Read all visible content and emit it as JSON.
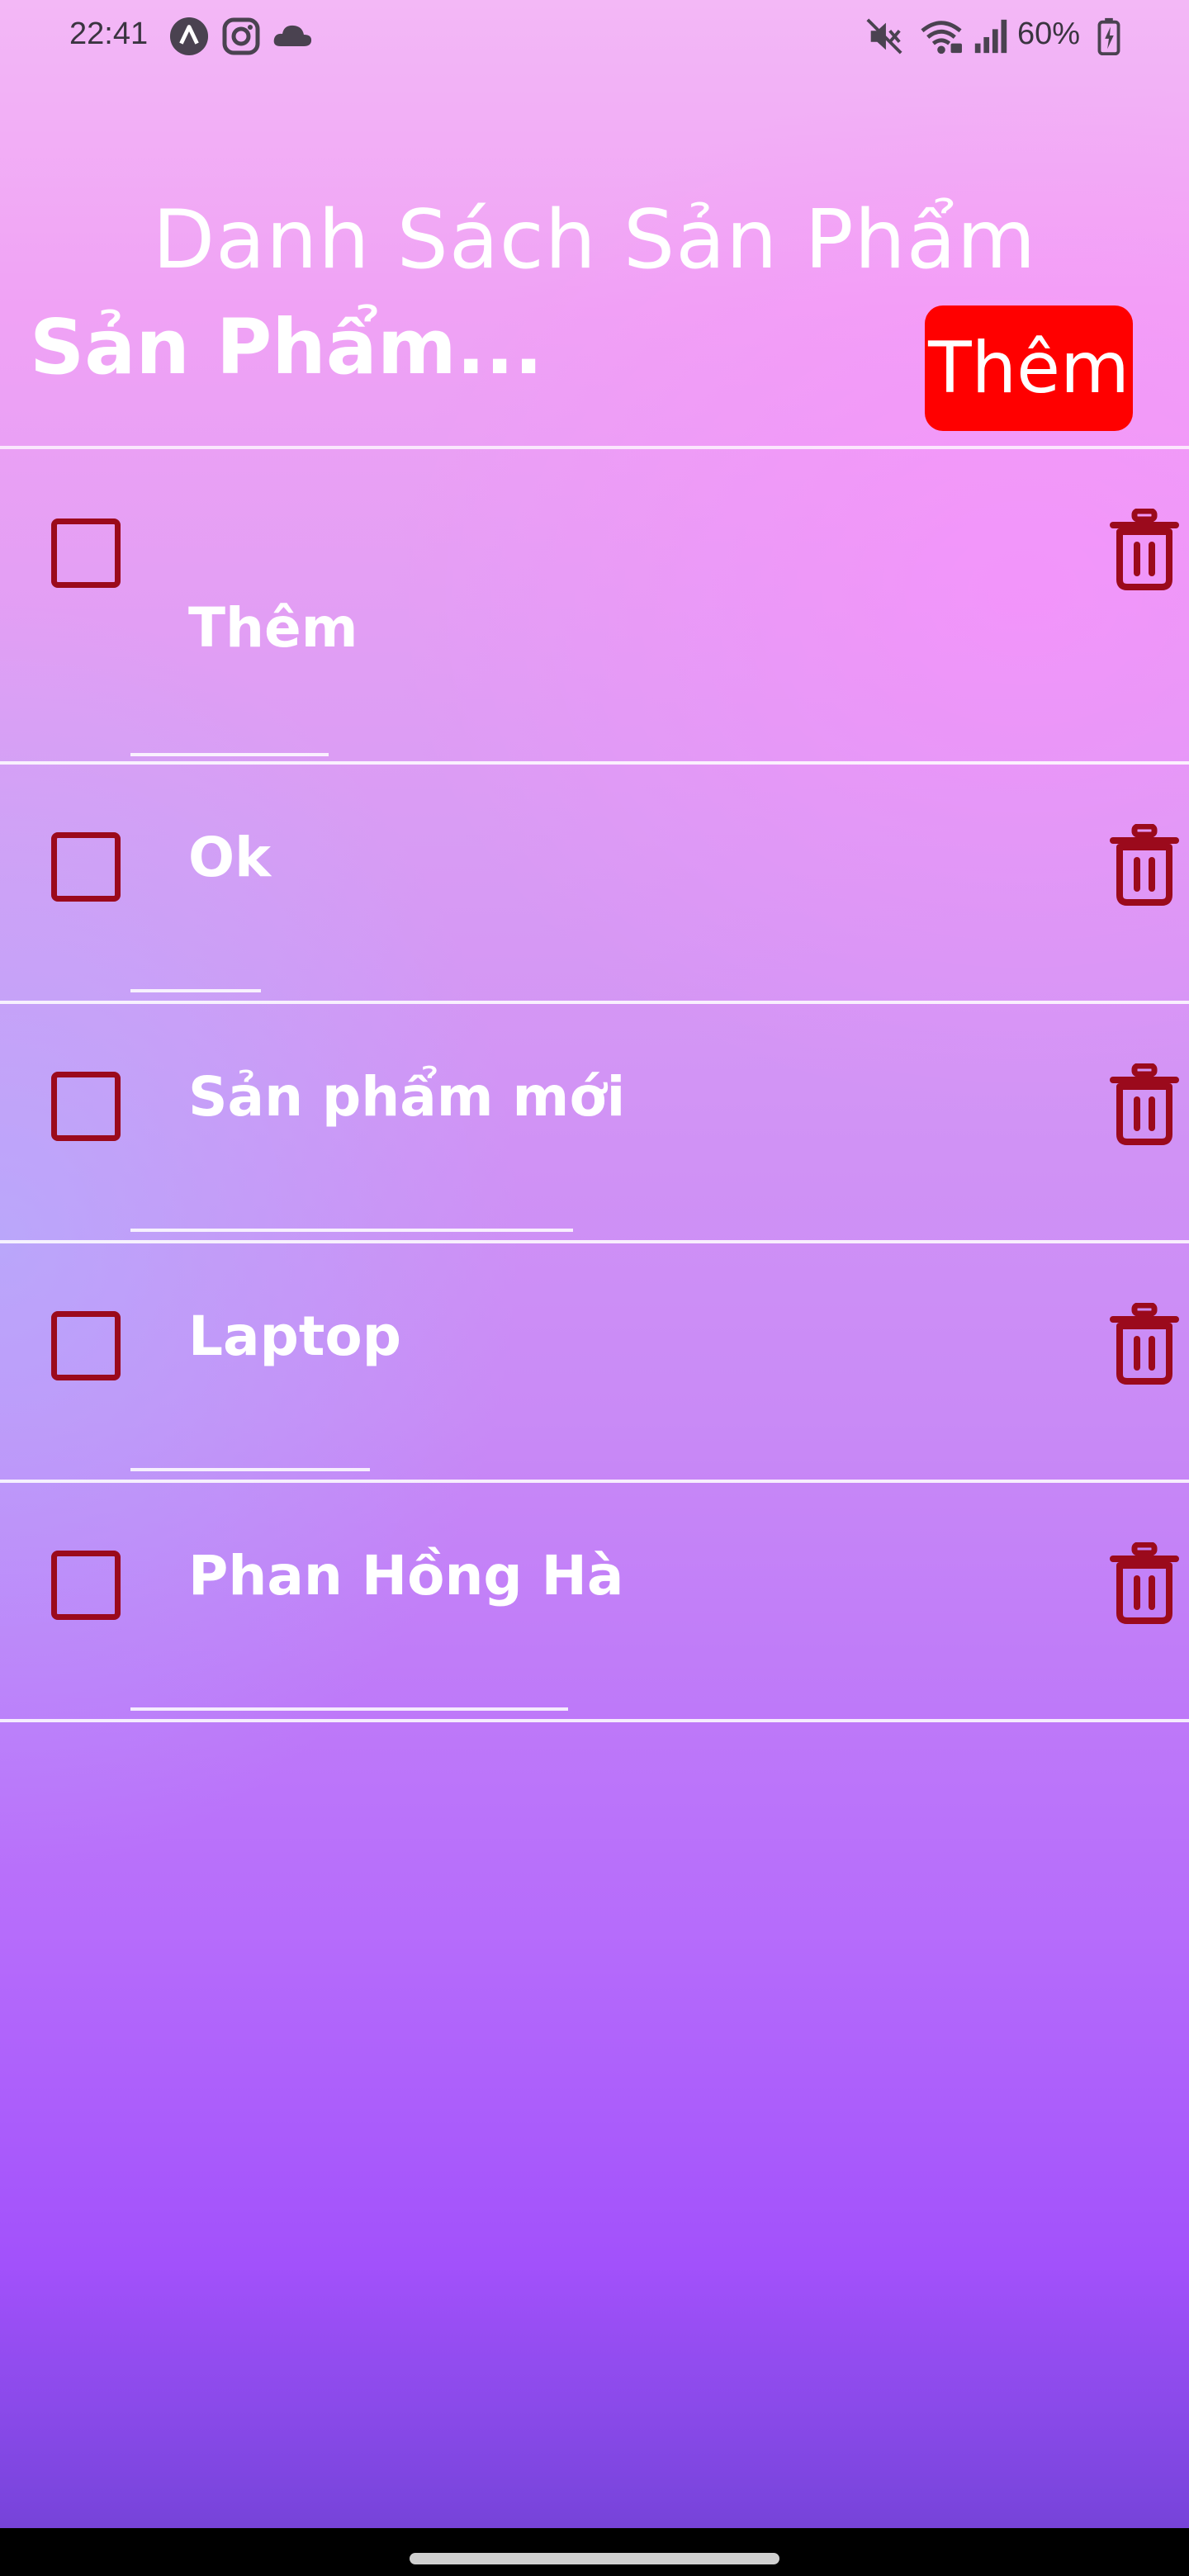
{
  "status_bar": {
    "time": "22:41",
    "battery": "60%",
    "left_icons": [
      "app-a-icon",
      "instagram-icon",
      "cloud-icon"
    ],
    "right_icons": [
      "mute-icon",
      "wifi-icon",
      "signal-icon",
      "battery-charging-icon"
    ]
  },
  "header": {
    "title": "Danh Sách Sản Phẩm",
    "input_placeholder": "Sản Phẩm...",
    "add_button_label": "Thêm"
  },
  "colors": {
    "accent_red": "#ff0000",
    "dark_red": "#9b0a1c",
    "text_white": "#ffffff"
  },
  "products": [
    {
      "name": "Thêm",
      "checked": false
    },
    {
      "name": "Ok",
      "checked": false
    },
    {
      "name": "Sản phẩm mới",
      "checked": false
    },
    {
      "name": "Laptop",
      "checked": false
    },
    {
      "name": "Phan Hồng Hà",
      "checked": false
    }
  ]
}
